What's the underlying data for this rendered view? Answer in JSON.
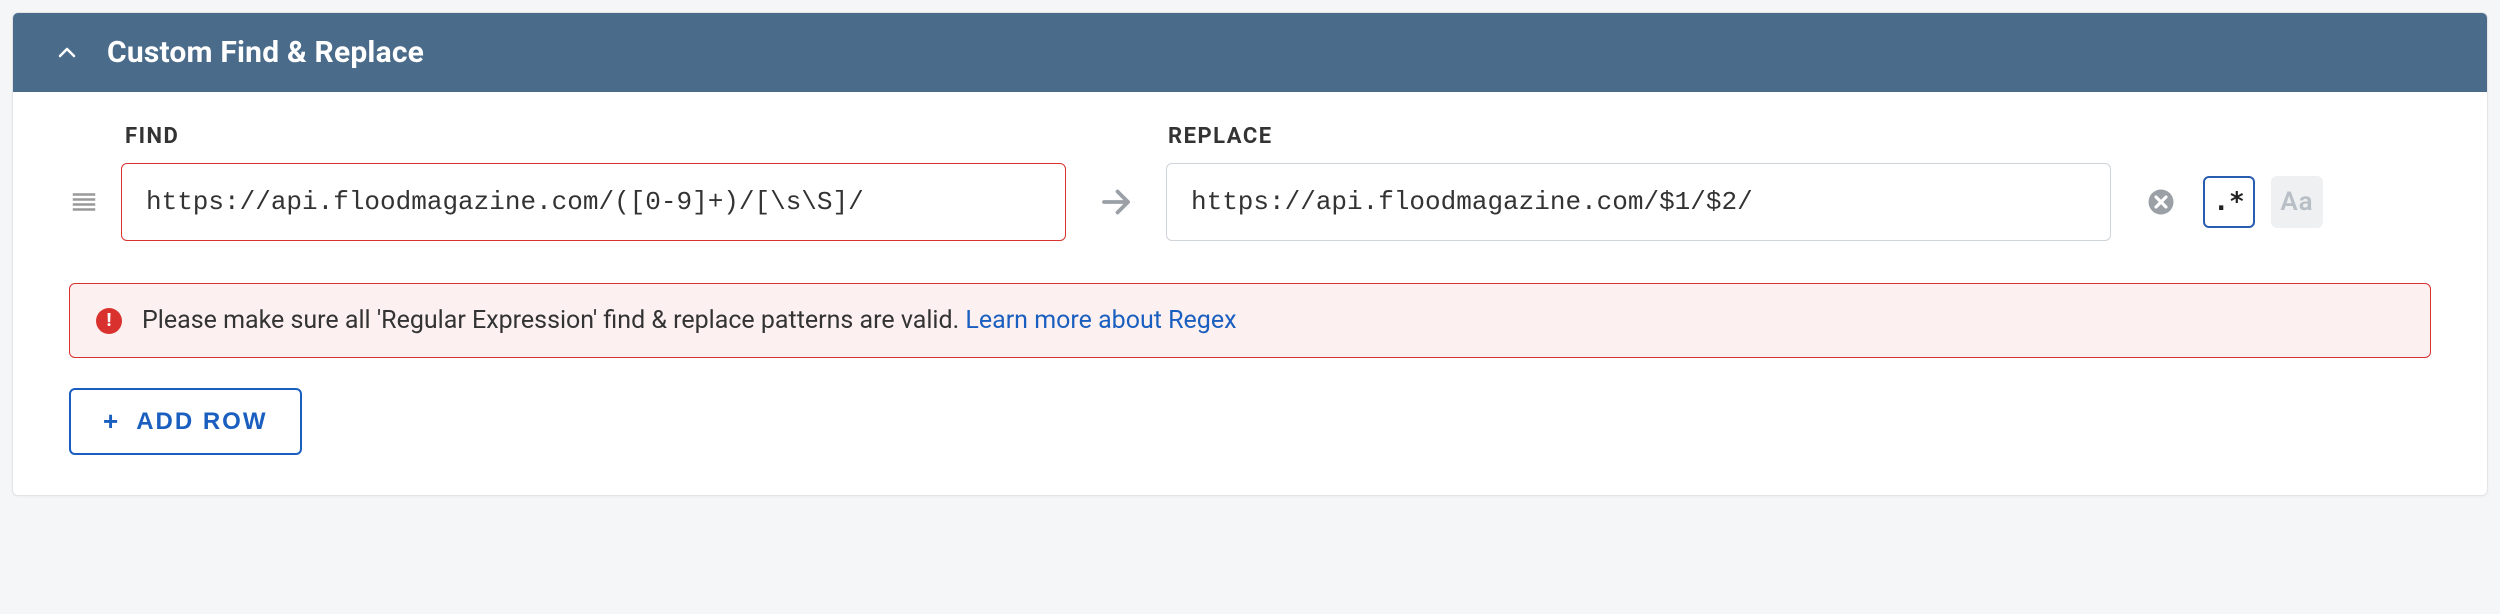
{
  "panel": {
    "title": "Custom Find & Replace",
    "expanded": true
  },
  "columns": {
    "find_label": "FIND",
    "replace_label": "REPLACE"
  },
  "rows": [
    {
      "find_value": "https://api.floodmagazine.com/([0-9]+)/[\\s\\S]/",
      "find_has_error": true,
      "replace_value": "https://api.floodmagazine.com/$1/$2/",
      "regex_toggle_label": ".*",
      "case_toggle_label": "Aa",
      "regex_active": true,
      "case_active": false
    }
  ],
  "alert": {
    "message": "Please make sure all 'Regular Expression' find & replace patterns are valid. ",
    "link_text": "Learn more about Regex"
  },
  "buttons": {
    "add_row_label": "ADD ROW"
  }
}
